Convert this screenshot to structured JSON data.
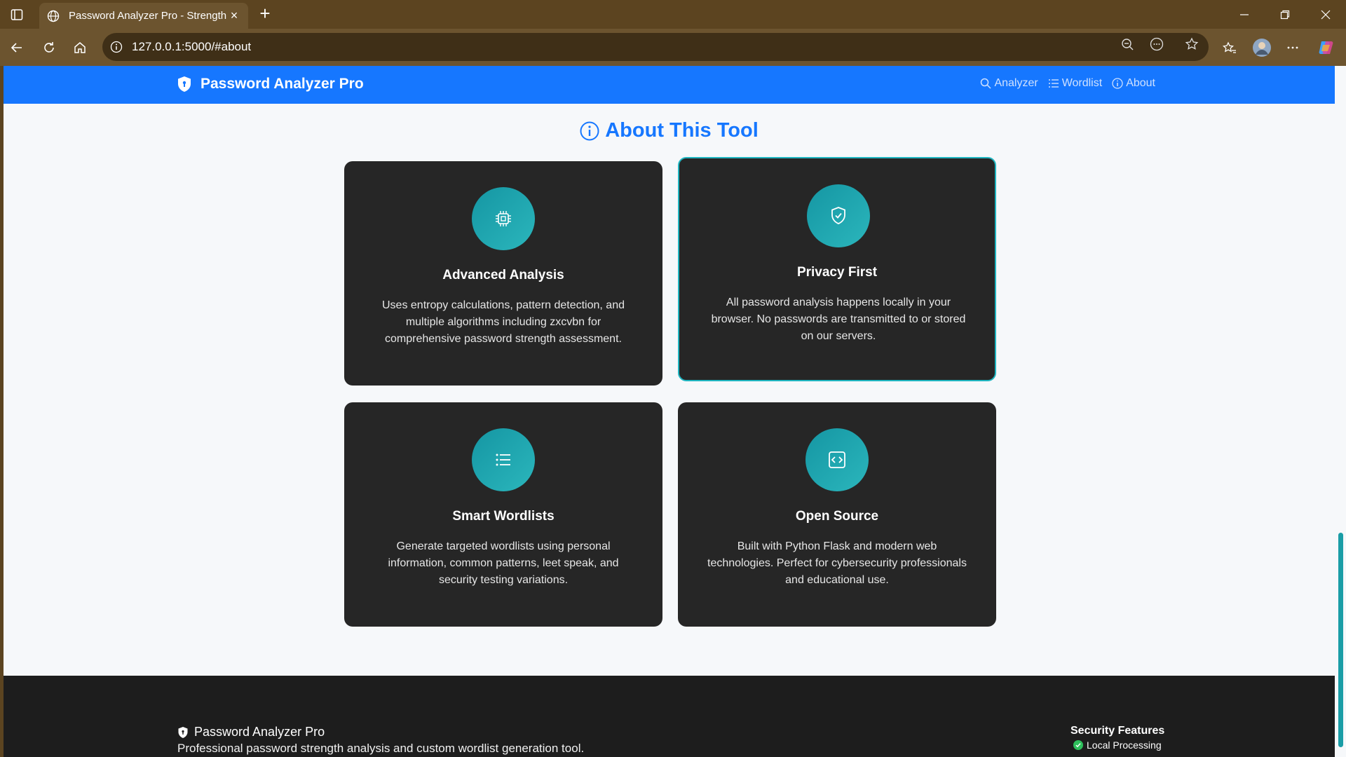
{
  "browser": {
    "tab_title": "Password Analyzer Pro - Strength",
    "url": "127.0.0.1:5000/#about"
  },
  "navbar": {
    "brand": "Password Analyzer Pro",
    "links": [
      {
        "label": "Analyzer",
        "icon": "search-icon"
      },
      {
        "label": "Wordlist",
        "icon": "list-icon"
      },
      {
        "label": "About",
        "icon": "info-icon"
      }
    ]
  },
  "about": {
    "title": "About This Tool",
    "cards": [
      {
        "title": "Advanced Analysis",
        "icon": "cpu-icon",
        "text": "Uses entropy calculations, pattern detection, and multiple algorithms including zxcvbn for comprehensive password strength assessment."
      },
      {
        "title": "Privacy First",
        "icon": "shield-check-icon",
        "text": "All password analysis happens locally in your browser. No passwords are transmitted to or stored on our servers."
      },
      {
        "title": "Smart Wordlists",
        "icon": "list-icon",
        "text": "Generate targeted wordlists using personal information, common patterns, leet speak, and security testing variations."
      },
      {
        "title": "Open Source",
        "icon": "code-icon",
        "text": "Built with Python Flask and modern web technologies. Perfect for cybersecurity professionals and educational use."
      }
    ]
  },
  "footer": {
    "brand": "Password Analyzer Pro",
    "description": "Professional password strength analysis and custom wordlist generation tool.",
    "security_title": "Security Features",
    "security_item": "Local Processing"
  },
  "colors": {
    "primary": "#1677ff",
    "accent": "#1fb6c1",
    "card_bg": "#262626",
    "chrome": "#5c4420"
  }
}
